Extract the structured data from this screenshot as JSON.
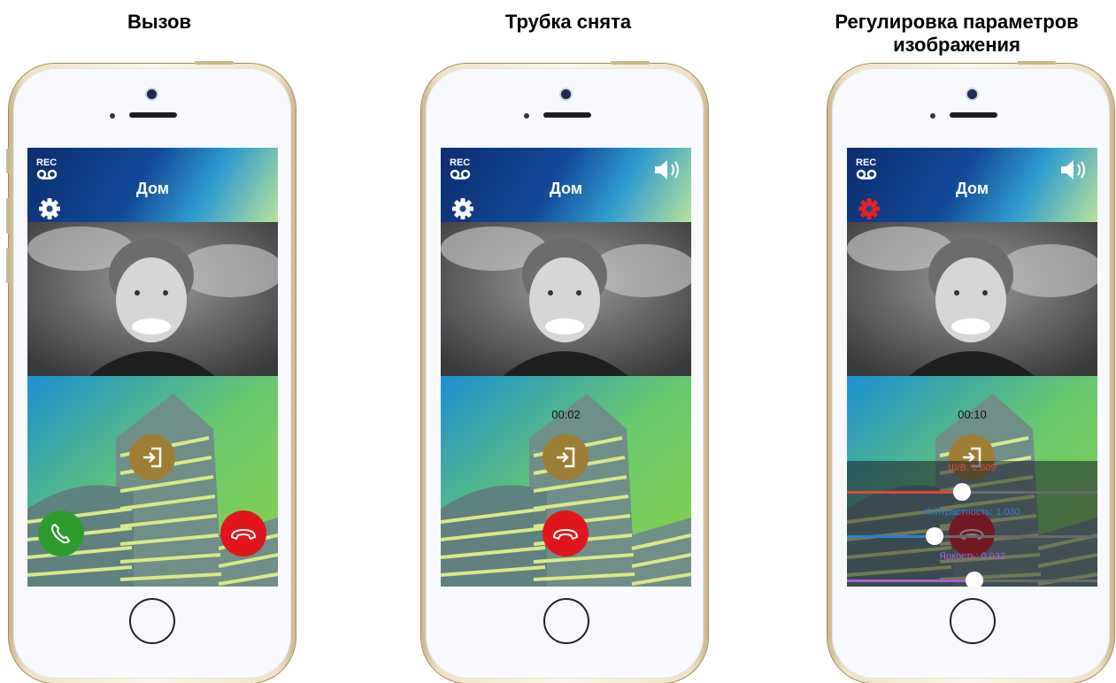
{
  "panels": [
    {
      "caption": "Вызов",
      "header_title": "Дом",
      "rec_label": "REC",
      "rec_tape": "oo",
      "gear_color": "#ffffff",
      "show_speaker": false,
      "show_timer": false,
      "timer": ""
    },
    {
      "caption": "Трубка снята",
      "header_title": "Дом",
      "rec_label": "REC",
      "rec_tape": "oo",
      "gear_color": "#ffffff",
      "show_speaker": true,
      "show_timer": true,
      "timer": "00:02"
    },
    {
      "caption": "Регулировка параметров изображения",
      "header_title": "Дом",
      "rec_label": "REC",
      "rec_tape": "oo",
      "gear_color": "#e8201f",
      "show_speaker": true,
      "show_timer": true,
      "timer": "00:10",
      "sliders": [
        {
          "label": "Ш/В: 1.609",
          "color": "#e0473a",
          "level": 0.46
        },
        {
          "label": "Контрастность: 1.030",
          "color": "#2f7fd9",
          "level": 0.35
        },
        {
          "label": "Яркость: 0.032",
          "color": "#b05ad8",
          "level": 0.51
        }
      ]
    }
  ],
  "colors": {
    "accept_green": "#2e9b2e",
    "decline_red": "#e0161c",
    "door_gold": "#9e7d34"
  },
  "icons": {
    "accept": "phone-accept-icon",
    "decline": "phone-hangup-icon",
    "door": "door-open-icon",
    "gear": "gear-icon",
    "speaker": "speaker-volume-icon",
    "rec": "recording-icon"
  }
}
